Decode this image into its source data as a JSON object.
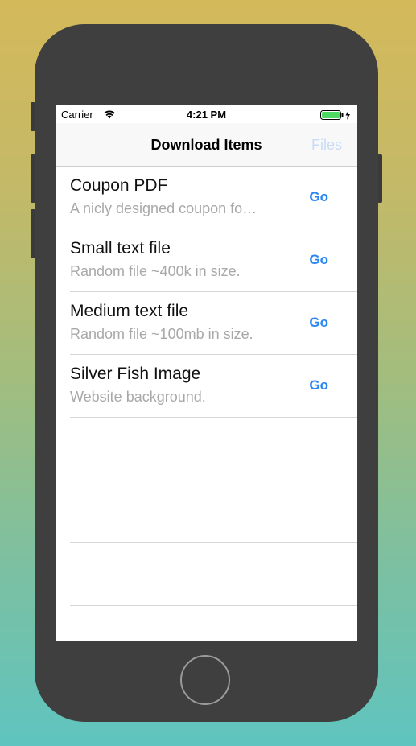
{
  "status_bar": {
    "carrier": "Carrier",
    "time": "4:21 PM",
    "wifi_icon": "wifi-icon",
    "battery_icon": "battery-charging-icon",
    "battery_color": "#4cd964"
  },
  "nav": {
    "title": "Download Items",
    "right_button": "Files"
  },
  "items": [
    {
      "title": "Coupon PDF",
      "subtitle": "A nicly designed coupon fo…",
      "action": "Go"
    },
    {
      "title": "Small text file",
      "subtitle": "Random file ~400k in size.",
      "action": "Go"
    },
    {
      "title": "Medium text file",
      "subtitle": "Random file ~100mb in size.",
      "action": "Go"
    },
    {
      "title": "Silver Fish Image",
      "subtitle": "Website background.",
      "action": "Go"
    }
  ],
  "colors": {
    "accent": "#2a86f3",
    "subtitle": "#a8a8a8",
    "phone_body": "#3f3f3f"
  }
}
